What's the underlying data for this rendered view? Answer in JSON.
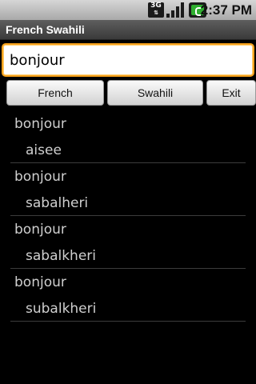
{
  "status_bar": {
    "network_label": "3G",
    "network_arrows": "⇅",
    "network_icon": "3g-network-icon",
    "signal_icon": "signal-strength-icon",
    "battery_icon": "battery-charging-icon",
    "time": "2:37 PM"
  },
  "app": {
    "title": "French Swahili"
  },
  "search": {
    "value": "bonjour"
  },
  "buttons": {
    "french": "French",
    "swahili": "Swahili",
    "exit": "Exit"
  },
  "results": [
    {
      "word": "bonjour",
      "translation": "aisee"
    },
    {
      "word": "bonjour",
      "translation": "sabalheri"
    },
    {
      "word": "bonjour",
      "translation": "sabalkheri"
    },
    {
      "word": "bonjour",
      "translation": "subalkheri"
    }
  ],
  "colors": {
    "input_focus_border": "#f7a21c",
    "background": "#000000",
    "result_text": "#cfcfcf"
  }
}
